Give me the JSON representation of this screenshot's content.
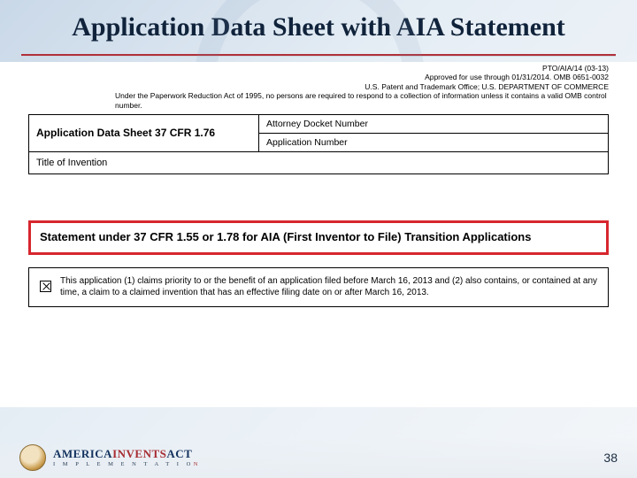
{
  "title": "Application Data Sheet with AIA Statement",
  "meta": {
    "line1": "PTO/AIA/14 (03-13)",
    "line2": "Approved for use through 01/31/2014. OMB 0651-0032",
    "line3": "U.S. Patent and Trademark Office; U.S. DEPARTMENT OF COMMERCE",
    "line4": "Under the Paperwork Reduction Act of 1995, no persons are required to respond to a collection of information unless it contains a valid OMB control number."
  },
  "grid": {
    "heading": "Application Data Sheet 37 CFR 1.76",
    "attorney_label": "Attorney Docket Number",
    "appnum_label": "Application Number",
    "title_label": "Title of Invention"
  },
  "highlight": {
    "heading": "Statement under 37 CFR 1.55 or 1.78 for AIA (First Inventor to File) Transition Applications"
  },
  "statement": {
    "checked": true,
    "text": "This application (1) claims priority to or the benefit of an application filed before March 16, 2013 and (2) also contains, or contained at any time, a claim to a claimed invention that has an effective filing date on or after March 16, 2013."
  },
  "footer": {
    "logo_blue": "AMERICA",
    "logo_red1": "INVENTS",
    "logo_red2": "ACT",
    "logo_sub_a": "I M P L E M E N T A T I O",
    "logo_sub_b": "N"
  },
  "page_number": "38"
}
